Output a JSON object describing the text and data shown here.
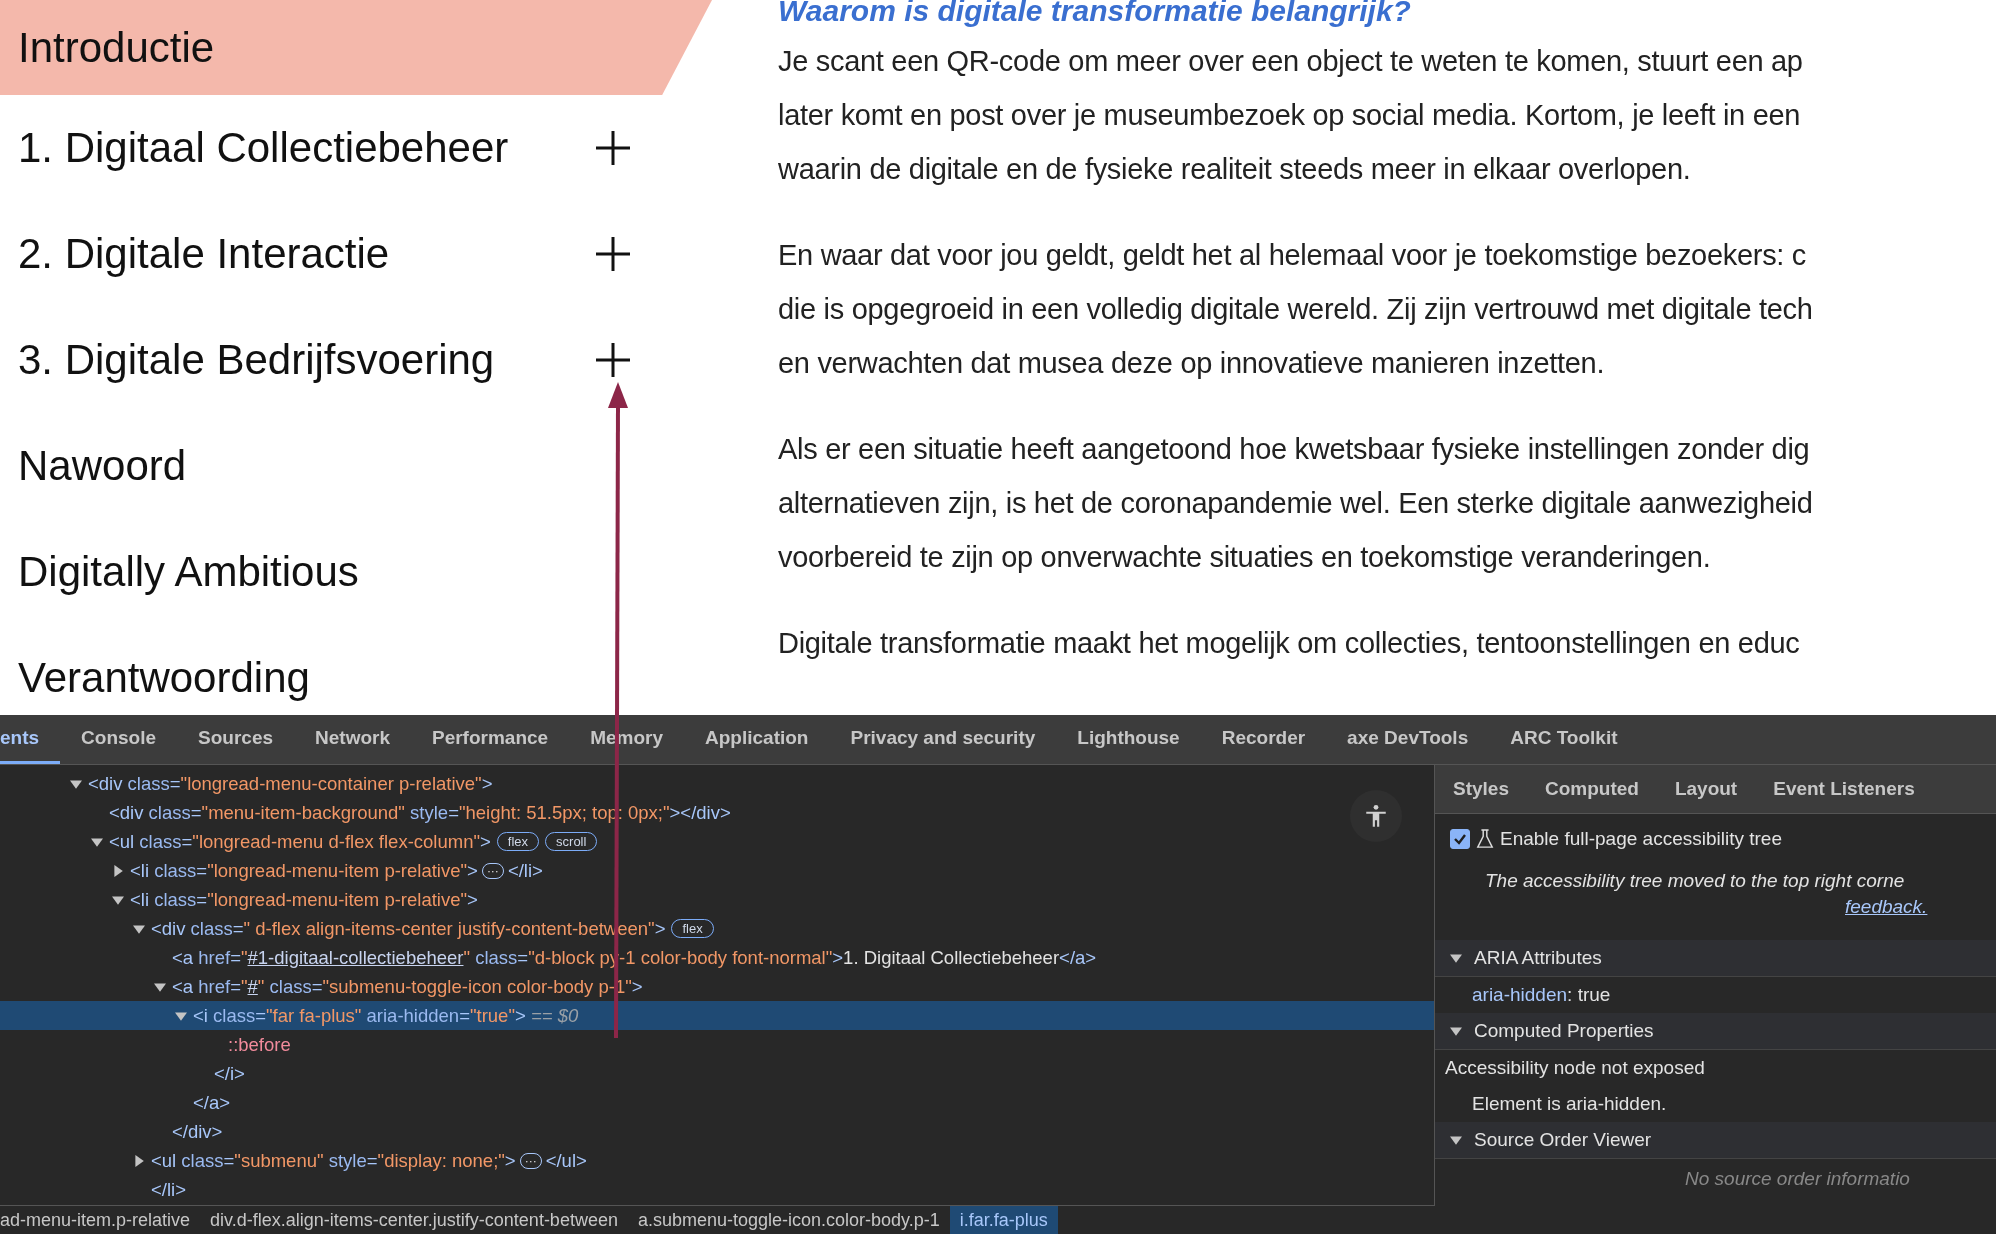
{
  "page": {
    "nav": [
      {
        "label": "Introductie",
        "selected": true
      },
      {
        "label": "1. Digitaal Collectiebeheer",
        "selected": false,
        "expanded": false
      },
      {
        "label": "2. Digitale Interactie",
        "selected": false,
        "expanded": false
      },
      {
        "label": "3. Digitale Bedrijfsvoering",
        "selected": false,
        "expanded": false
      },
      {
        "label": "Nawoord",
        "selected": false
      },
      {
        "label": "Digitally Ambitious",
        "selected": false
      },
      {
        "label": "Verantwoording",
        "selected": false
      }
    ],
    "heading": "Waarom is digitale transformatie belangrijk?",
    "paragraphs": [
      [
        "Je scant een QR-code om meer over een object te weten te komen, stuurt een ap",
        "later komt en post over je museumbezoek op social media. Kortom, je leeft in een",
        "waarin de digitale en de fysieke realiteit steeds meer in elkaar overlopen."
      ],
      [
        "En waar dat voor jou geldt, geldt het al helemaal voor je toekomstige bezoekers: c",
        "die is opgegroeid in een volledig digitale wereld. Zij zijn vertrouwd met digitale tech",
        "en verwachten dat musea deze op innovatieve manieren inzetten."
      ],
      [
        "Als er een situatie heeft aangetoond hoe kwetsbaar fysieke instellingen zonder dig",
        "alternatieven zijn, is het de coronapandemie wel. Een sterke digitale aanwezigheid",
        "voorbereid te zijn op onverwachte situaties en toekomstige veranderingen."
      ],
      [
        "Digitale transformatie maakt het mogelijk om collecties, tentoonstellingen en educ"
      ]
    ]
  },
  "devtools": {
    "tabs": [
      {
        "label": "ents",
        "selected": true
      },
      {
        "label": "Console",
        "selected": false
      },
      {
        "label": "Sources",
        "selected": false
      },
      {
        "label": "Network",
        "selected": false
      },
      {
        "label": "Performance",
        "selected": false
      },
      {
        "label": "Memory",
        "selected": false
      },
      {
        "label": "Application",
        "selected": false
      },
      {
        "label": "Privacy and security",
        "selected": false
      },
      {
        "label": "Lighthouse",
        "selected": false
      },
      {
        "label": "Recorder",
        "selected": false
      },
      {
        "label": "axe DevTools",
        "selected": false
      },
      {
        "label": "ARC Toolkit",
        "selected": false
      }
    ],
    "dom": [
      {
        "expanded": true,
        "selected": false,
        "tokens": [
          {
            "kind": "tag",
            "text": "<div"
          },
          {
            "kind": "attr",
            "text": " class"
          },
          {
            "kind": "tag",
            "text": "="
          },
          {
            "kind": "value",
            "text": "\"longread-menu-container p-relative\""
          },
          {
            "kind": "tag",
            "text": ">"
          }
        ],
        "children": [
          {
            "selected": false,
            "tokens": [
              {
                "kind": "tag",
                "text": "<div"
              },
              {
                "kind": "attr",
                "text": " class"
              },
              {
                "kind": "tag",
                "text": "="
              },
              {
                "kind": "value",
                "text": "\"menu-item-background\""
              },
              {
                "kind": "attr",
                "text": " style"
              },
              {
                "kind": "tag",
                "text": "="
              },
              {
                "kind": "value",
                "text": "\"height: 51.5px; top: 0px;\""
              },
              {
                "kind": "tag",
                "text": "></div>"
              }
            ]
          },
          {
            "expanded": true,
            "selected": false,
            "tokens": [
              {
                "kind": "tag",
                "text": "<ul"
              },
              {
                "kind": "attr",
                "text": " class"
              },
              {
                "kind": "tag",
                "text": "="
              },
              {
                "kind": "value",
                "text": "\"longread-menu d-flex flex-column\""
              },
              {
                "kind": "tag",
                "text": ">"
              },
              {
                "kind": "badge",
                "text": "flex"
              },
              {
                "kind": "badge",
                "text": "scroll"
              }
            ],
            "children": [
              {
                "expanded": false,
                "selected": false,
                "tokens": [
                  {
                    "kind": "tag",
                    "text": "<li"
                  },
                  {
                    "kind": "attr",
                    "text": " class"
                  },
                  {
                    "kind": "tag",
                    "text": "="
                  },
                  {
                    "kind": "value",
                    "text": "\"longread-menu-item p-relative\""
                  },
                  {
                    "kind": "tag",
                    "text": ">"
                  },
                  {
                    "kind": "ellipsis",
                    "text": "···"
                  },
                  {
                    "kind": "tag",
                    "text": "</li>"
                  }
                ]
              },
              {
                "expanded": true,
                "selected": false,
                "tokens": [
                  {
                    "kind": "tag",
                    "text": "<li"
                  },
                  {
                    "kind": "attr",
                    "text": " class"
                  },
                  {
                    "kind": "tag",
                    "text": "="
                  },
                  {
                    "kind": "value",
                    "text": "\"longread-menu-item p-relative\""
                  },
                  {
                    "kind": "tag",
                    "text": ">"
                  }
                ],
                "children": [
                  {
                    "expanded": true,
                    "selected": false,
                    "tokens": [
                      {
                        "kind": "tag",
                        "text": "<div"
                      },
                      {
                        "kind": "attr",
                        "text": " class"
                      },
                      {
                        "kind": "tag",
                        "text": "="
                      },
                      {
                        "kind": "value",
                        "text": "\" d-flex align-items-center justify-content-between\""
                      },
                      {
                        "kind": "tag",
                        "text": ">"
                      },
                      {
                        "kind": "badge",
                        "text": "flex"
                      }
                    ],
                    "children": [
                      {
                        "selected": false,
                        "tokens": [
                          {
                            "kind": "tag",
                            "text": "<a"
                          },
                          {
                            "kind": "attr",
                            "text": " href"
                          },
                          {
                            "kind": "tag",
                            "text": "="
                          },
                          {
                            "kind": "value",
                            "text": "\""
                          },
                          {
                            "kind": "link",
                            "text": "#1-digitaal-collectiebeheer"
                          },
                          {
                            "kind": "value",
                            "text": "\""
                          },
                          {
                            "kind": "attr",
                            "text": " class"
                          },
                          {
                            "kind": "tag",
                            "text": "="
                          },
                          {
                            "kind": "value",
                            "text": "\"d-block py-1 color-body font-normal\""
                          },
                          {
                            "kind": "tag",
                            "text": ">"
                          },
                          {
                            "kind": "text",
                            "text": "1. Digitaal Collectiebeheer"
                          },
                          {
                            "kind": "tag",
                            "text": "</a>"
                          }
                        ]
                      },
                      {
                        "expanded": true,
                        "selected": false,
                        "tokens": [
                          {
                            "kind": "tag",
                            "text": "<a"
                          },
                          {
                            "kind": "attr",
                            "text": " href"
                          },
                          {
                            "kind": "tag",
                            "text": "="
                          },
                          {
                            "kind": "value",
                            "text": "\""
                          },
                          {
                            "kind": "link",
                            "text": "#"
                          },
                          {
                            "kind": "value",
                            "text": "\""
                          },
                          {
                            "kind": "attr",
                            "text": " class"
                          },
                          {
                            "kind": "tag",
                            "text": "="
                          },
                          {
                            "kind": "value",
                            "text": "\"submenu-toggle-icon color-body p-1\""
                          },
                          {
                            "kind": "tag",
                            "text": ">"
                          }
                        ],
                        "children": [
                          {
                            "expanded": true,
                            "selected": true,
                            "tokens": [
                              {
                                "kind": "tag",
                                "text": "<i"
                              },
                              {
                                "kind": "attr",
                                "text": " class"
                              },
                              {
                                "kind": "tag",
                                "text": "="
                              },
                              {
                                "kind": "value",
                                "text": "\"far fa-plus\""
                              },
                              {
                                "kind": "attr",
                                "text": " aria-hidden"
                              },
                              {
                                "kind": "tag",
                                "text": "="
                              },
                              {
                                "kind": "value",
                                "text": "\"true\""
                              },
                              {
                                "kind": "tag",
                                "text": ">"
                              },
                              {
                                "kind": "dollar",
                                "text": " == $0"
                              }
                            ],
                            "children": [
                              {
                                "selected": false,
                                "tokens": [
                                  {
                                    "kind": "pseudo",
                                    "text": "::before"
                                  }
                                ]
                              },
                              {
                                "selected": false,
                                "tokens": [
                                  {
                                    "kind": "tag",
                                    "text": "</i>"
                                  }
                                ]
                              }
                            ]
                          },
                          {
                            "selected": false,
                            "tokens": [
                              {
                                "kind": "tag",
                                "text": "</a>"
                              }
                            ]
                          }
                        ]
                      },
                      {
                        "selected": false,
                        "tokens": [
                          {
                            "kind": "tag",
                            "text": "</div>"
                          }
                        ]
                      }
                    ]
                  },
                  {
                    "expanded": false,
                    "selected": false,
                    "tokens": [
                      {
                        "kind": "tag",
                        "text": "<ul"
                      },
                      {
                        "kind": "attr",
                        "text": " class"
                      },
                      {
                        "kind": "tag",
                        "text": "="
                      },
                      {
                        "kind": "value",
                        "text": "\"submenu\""
                      },
                      {
                        "kind": "attr",
                        "text": " style"
                      },
                      {
                        "kind": "tag",
                        "text": "="
                      },
                      {
                        "kind": "value",
                        "text": "\"display: none;\""
                      },
                      {
                        "kind": "tag",
                        "text": ">"
                      },
                      {
                        "kind": "ellipsis",
                        "text": "···"
                      },
                      {
                        "kind": "tag",
                        "text": "</ul>"
                      }
                    ]
                  },
                  {
                    "selected": false,
                    "tokens": [
                      {
                        "kind": "tag",
                        "text": "</li>"
                      }
                    ]
                  }
                ]
              }
            ]
          }
        ]
      }
    ],
    "breadcrumbs": [
      {
        "label": "ad-menu-item.p-relative",
        "selected": false
      },
      {
        "label": "div.d-flex.align-items-center.justify-content-between",
        "selected": false
      },
      {
        "label": "a.submenu-toggle-icon.color-body.p-1",
        "selected": false
      },
      {
        "label": "i.far.fa-plus",
        "selected": true
      }
    ],
    "side_tabs": [
      {
        "label": "Styles",
        "selected": false
      },
      {
        "label": "Computed",
        "selected": false
      },
      {
        "label": "Layout",
        "selected": false
      },
      {
        "label": "Event Listeners",
        "selected": false
      }
    ],
    "accessibility": {
      "full_tree": {
        "label": "Enable full-page accessibility tree",
        "checked": true
      },
      "note": "The accessibility tree moved to the top right corne",
      "note_link": "feedback.",
      "sections": [
        {
          "title": "ARIA Attributes",
          "expanded": true,
          "rows": [
            {
              "kind": "attribute",
              "name": "aria-hidden",
              "value": ": true"
            }
          ]
        },
        {
          "title": "Computed Properties",
          "expanded": true,
          "rows": [
            {
              "kind": "heading",
              "text": "Accessibility node not exposed"
            },
            {
              "kind": "reason",
              "text": "Element is aria-hidden."
            }
          ]
        },
        {
          "title": "Source Order Viewer",
          "expanded": true,
          "rows": [
            {
              "kind": "empty",
              "text": "No source order informatio"
            }
          ]
        }
      ]
    }
  }
}
